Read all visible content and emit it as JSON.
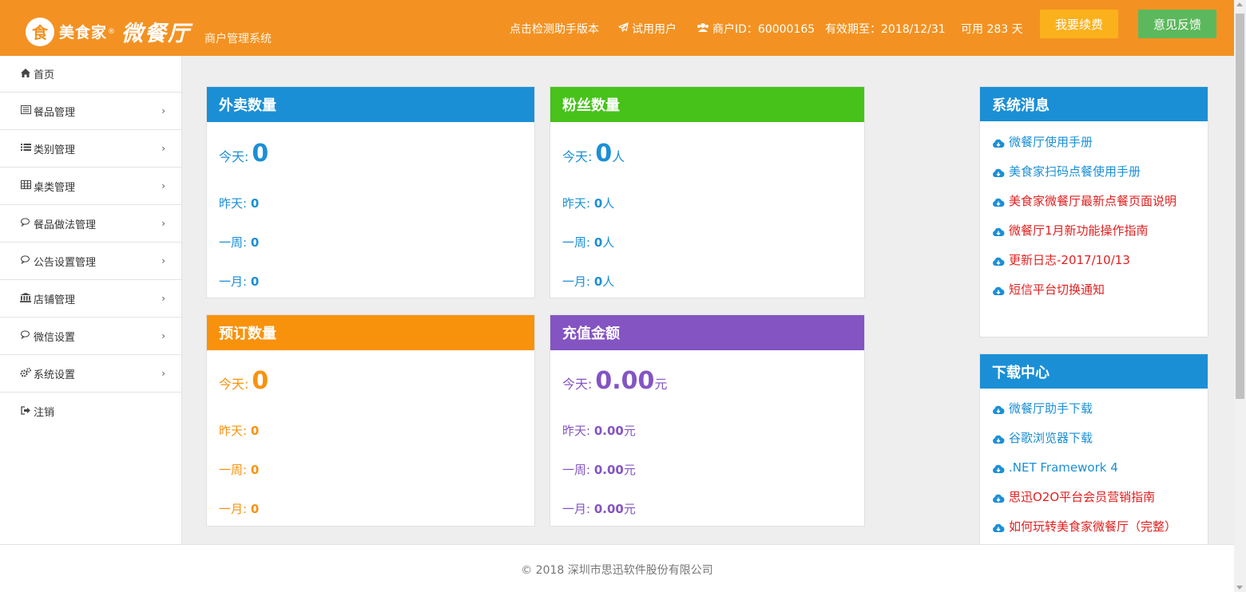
{
  "header": {
    "logo_badge": "食",
    "brand": "美食家",
    "reg_mark": "®",
    "product": "微餐厅",
    "subtitle": "商户管理系统",
    "check_version": "点击检测助手版本",
    "trial_user": "试用用户",
    "merchant_id": "商户ID：60000165",
    "expiry": "有效期至：2018/12/31",
    "days_left": "可用 283 天",
    "renew_button": "我要续费",
    "feedback_button": "意见反馈"
  },
  "sidebar": {
    "items": [
      {
        "label": "首页",
        "icon": "home-icon"
      },
      {
        "label": "餐品管理",
        "icon": "list-alt-icon"
      },
      {
        "label": "类别管理",
        "icon": "list-icon"
      },
      {
        "label": "桌类管理",
        "icon": "table-icon"
      },
      {
        "label": "餐品做法管理",
        "icon": "comments-icon"
      },
      {
        "label": "公告设置管理",
        "icon": "comments-icon"
      },
      {
        "label": "店铺管理",
        "icon": "bank-icon"
      },
      {
        "label": "微信设置",
        "icon": "comments-icon"
      },
      {
        "label": "系统设置",
        "icon": "cogs-icon"
      },
      {
        "label": "注销",
        "icon": "sign-out-icon"
      }
    ]
  },
  "cards": {
    "takeout": {
      "title": "外卖数量",
      "today_label": "今天:",
      "today_value": "0",
      "today_unit": "",
      "yesterday_label": "昨天:",
      "yesterday_value": "0",
      "yesterday_unit": "",
      "week_label": "一周:",
      "week_value": "0",
      "week_unit": "",
      "month_label": "一月:",
      "month_value": "0",
      "month_unit": ""
    },
    "fans": {
      "title": "粉丝数量",
      "today_label": "今天:",
      "today_value": "0",
      "today_unit": "人",
      "yesterday_label": "昨天:",
      "yesterday_value": "0",
      "yesterday_unit": "人",
      "week_label": "一周:",
      "week_value": "0",
      "week_unit": "人",
      "month_label": "一月:",
      "month_value": "0",
      "month_unit": "人"
    },
    "reservation": {
      "title": "预订数量",
      "today_label": "今天:",
      "today_value": "0",
      "today_unit": "",
      "yesterday_label": "昨天:",
      "yesterday_value": "0",
      "yesterday_unit": "",
      "week_label": "一周:",
      "week_value": "0",
      "week_unit": "",
      "month_label": "一月:",
      "month_value": "0",
      "month_unit": ""
    },
    "recharge": {
      "title": "充值金额",
      "today_label": "今天:",
      "today_value": "0.00",
      "today_unit": "元",
      "yesterday_label": "昨天:",
      "yesterday_value": "0.00",
      "yesterday_unit": "元",
      "week_label": "一周:",
      "week_value": "0.00",
      "week_unit": "元",
      "month_label": "一月:",
      "month_value": "0.00",
      "month_unit": "元"
    }
  },
  "system_messages": {
    "title": "系统消息",
    "items": [
      {
        "label": "微餐厅使用手册",
        "color": "#1b8fd5"
      },
      {
        "label": "美食家扫码点餐使用手册",
        "color": "#1b8fd5"
      },
      {
        "label": "美食家微餐厅最新点餐页面说明",
        "color": "#e02020"
      },
      {
        "label": "微餐厅1月新功能操作指南",
        "color": "#e02020"
      },
      {
        "label": "更新日志-2017/10/13",
        "color": "#e02020"
      },
      {
        "label": "短信平台切换通知",
        "color": "#e02020"
      }
    ]
  },
  "download_center": {
    "title": "下载中心",
    "items": [
      {
        "label": "微餐厅助手下载",
        "color": "#1b8fd5"
      },
      {
        "label": "谷歌浏览器下载",
        "color": "#1b8fd5"
      },
      {
        "label": ".NET Framework 4",
        "color": "#1b8fd5"
      },
      {
        "label": "思迅O2O平台会员营销指南",
        "color": "#e02020"
      },
      {
        "label": "如何玩转美食家微餐厅（完整）",
        "color": "#e02020"
      }
    ]
  },
  "footer": {
    "copyright": "© 2018 深圳市思迅软件股份有限公司"
  },
  "colors": {
    "header_bg": "#f39222",
    "takeout": "#1b8fd5",
    "fans": "#47c21a",
    "reservation": "#f8920d",
    "recharge": "#8454c3",
    "renew_button": "#fbb11c",
    "feedback_button": "#5cb85c"
  }
}
